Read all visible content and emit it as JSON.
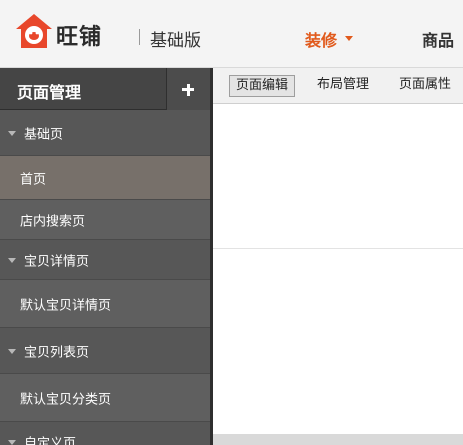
{
  "header": {
    "brand": "旺铺",
    "edition": "基础版",
    "nav": {
      "decorate": "装修",
      "goods": "商品"
    },
    "colors": {
      "accent": "#e15a1c",
      "logo": "#e8472b"
    }
  },
  "sidebar": {
    "title": "页面管理",
    "add_icon": "plus-icon",
    "rows": [
      {
        "type": "group",
        "label": "基础页"
      },
      {
        "type": "item",
        "label": "首页",
        "active": true
      },
      {
        "type": "item",
        "label": "店内搜索页"
      },
      {
        "type": "group",
        "label": "宝贝详情页"
      },
      {
        "type": "item",
        "label": "默认宝贝详情页"
      },
      {
        "type": "group",
        "label": "宝贝列表页"
      },
      {
        "type": "item",
        "label": "默认宝贝分类页"
      },
      {
        "type": "group",
        "label": "自定义页"
      }
    ]
  },
  "main": {
    "tabs": [
      {
        "label": "页面编辑",
        "active": true
      },
      {
        "label": "布局管理"
      },
      {
        "label": "页面属性"
      }
    ]
  }
}
